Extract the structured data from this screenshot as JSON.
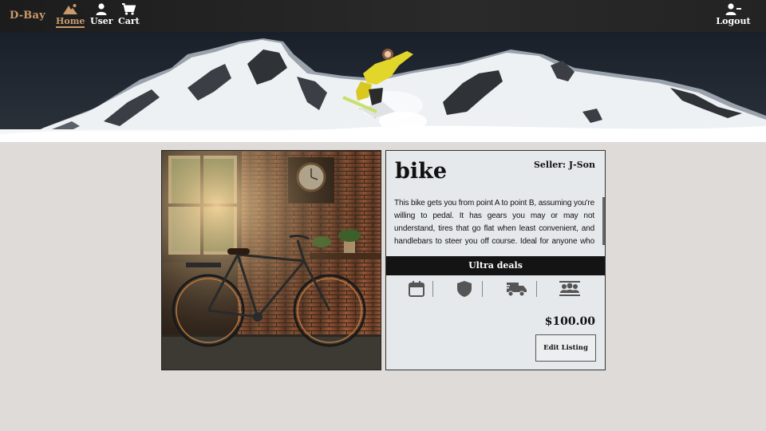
{
  "nav": {
    "brand": "D-Bay",
    "items": [
      {
        "label": "Home",
        "icon": "home-mountain-icon",
        "active": true
      },
      {
        "label": "User",
        "icon": "user-icon",
        "active": false
      },
      {
        "label": "Cart",
        "icon": "cart-icon",
        "active": false
      }
    ],
    "logout": {
      "label": "Logout",
      "icon": "user-minus-icon"
    }
  },
  "hero": {
    "image": "snowy-mountains-snowboarder-banner"
  },
  "product": {
    "image": "bicycle-photo",
    "title": "bike",
    "seller": "Seller: J-Son",
    "description": "This bike gets you from point A to point B, assuming you're willing to pedal. It has gears you may or may not understand, tires that go flat when least convenient, and handlebars to steer you off course. Ideal for anyone who enjoys mild exertion and occasional frustration.",
    "deals_label": "Ultra deals",
    "features": [
      "calendar-icon",
      "shield-icon",
      "delivery-truck-icon",
      "group-icon"
    ],
    "price": "$100.00",
    "edit_label": "Edit Listing"
  },
  "colors": {
    "nav_bg": "#1c1c1c",
    "accent": "#c99a6c",
    "page_bg": "#dfdbd9",
    "card_bg": "#e6e9eb",
    "deals_bg": "#141414"
  }
}
